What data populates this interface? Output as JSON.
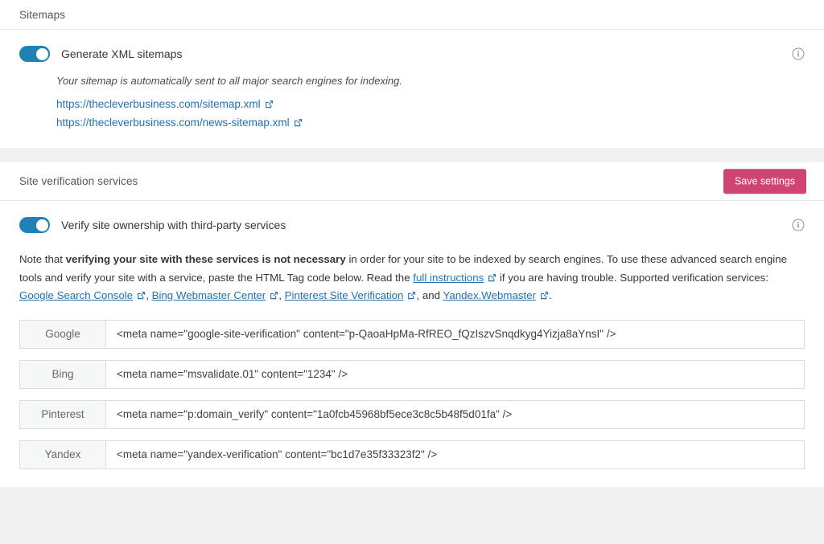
{
  "sitemaps": {
    "section_title": "Sitemaps",
    "toggle_label": "Generate XML sitemaps",
    "toggle_state": "on",
    "help_text": "Your sitemap is automatically sent to all major search engines for indexing.",
    "info_icon": "info-circle-icon",
    "links": [
      {
        "label": "https://thecleverbusiness.com/sitemap.xml",
        "icon": "external-link-icon"
      },
      {
        "label": "https://thecleverbusiness.com/news-sitemap.xml",
        "icon": "external-link-icon"
      }
    ]
  },
  "verification": {
    "section_title": "Site verification services",
    "save_label": "Save settings",
    "save_color": "#cf4470",
    "toggle_label": "Verify site ownership with third-party services",
    "toggle_state": "on",
    "info_icon": "info-circle-icon",
    "note": {
      "part1": "Note that ",
      "bold1": "verifying your site with these services is not necessary",
      "part2": " in order for your site to be indexed by search engines. To use these advanced search engine tools and verify your site with a service, paste the HTML Tag code below. Read the ",
      "link_full_instructions": "full instructions",
      "part3": " if you are having trouble. Supported verification services: ",
      "link_google": "Google Search Console",
      "sep1": ", ",
      "link_bing": "Bing Webmaster Center",
      "sep2": ", ",
      "link_pinterest": "Pinterest Site Verification",
      "sep3": ", and ",
      "link_yandex": "Yandex.Webmaster",
      "end": "."
    },
    "fields": [
      {
        "label": "Google",
        "value": "<meta name=\"google-site-verification\" content=\"p-QaoaHpMa-RfREO_fQzIszvSnqdkyg4Yizja8aYnsI\" />",
        "name": "google-verification-input"
      },
      {
        "label": "Bing",
        "value": "<meta name=\"msvalidate.01\" content=\"1234\" />",
        "name": "bing-verification-input"
      },
      {
        "label": "Pinterest",
        "value": "<meta name=\"p:domain_verify\" content=\"1a0fcb45968bf5ece3c8c5b48f5d01fa\" />",
        "name": "pinterest-verification-input"
      },
      {
        "label": "Yandex",
        "value": "<meta name=\"yandex-verification\" content=\"bc1d7e35f33323f2\" />",
        "name": "yandex-verification-input"
      }
    ]
  }
}
